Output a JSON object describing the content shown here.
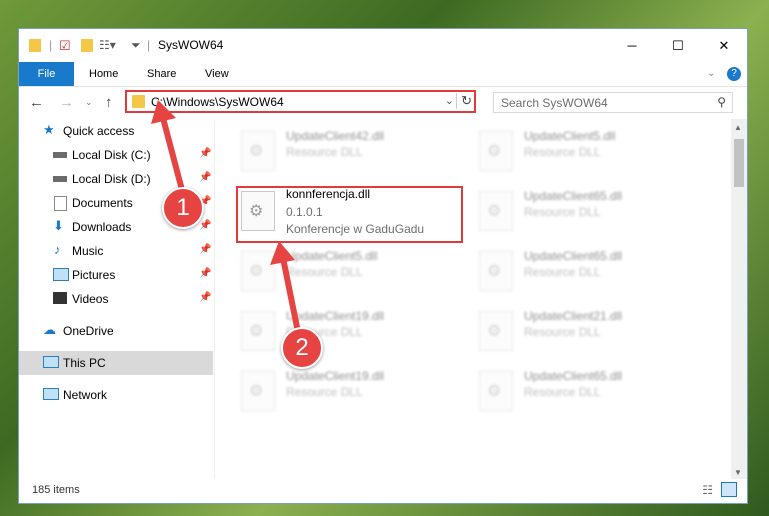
{
  "window": {
    "title": "SysWOW64"
  },
  "ribbon": {
    "tabs": [
      "File",
      "Home",
      "Share",
      "View"
    ]
  },
  "address": {
    "path": "C:\\Windows\\SysWOW64"
  },
  "search": {
    "placeholder": "Search SysWOW64"
  },
  "nav": {
    "items": [
      {
        "label": "Quick access"
      },
      {
        "label": "Local Disk (C:)"
      },
      {
        "label": "Local Disk (D:)"
      },
      {
        "label": "Documents"
      },
      {
        "label": "Downloads"
      },
      {
        "label": "Music"
      },
      {
        "label": "Pictures"
      },
      {
        "label": "Videos"
      },
      {
        "label": "OneDrive"
      },
      {
        "label": "This PC"
      },
      {
        "label": "Network"
      }
    ]
  },
  "files": [
    {
      "name": "UpdateClient42.dll",
      "sub": "Resource DLL"
    },
    {
      "name": "UpdateClient5.dll",
      "sub": "Resource DLL"
    },
    {
      "name": "konnferencja.dll",
      "sub": "0.1.0.1",
      "sub2": "Konferencje w GaduGadu"
    },
    {
      "name": "UpdateClient65.dll",
      "sub": "Resource DLL"
    },
    {
      "name": "UpdateClient5.dll",
      "sub": "Resource DLL"
    },
    {
      "name": "UpdateClient65.dll",
      "sub": "Resource DLL"
    },
    {
      "name": "UpdateClient19.dll",
      "sub": "Resource DLL"
    },
    {
      "name": "UpdateClient21.dll",
      "sub": "Resource DLL"
    },
    {
      "name": "UpdateClient19.dll",
      "sub": "Resource DLL"
    },
    {
      "name": "UpdateClient65.dll",
      "sub": "Resource DLL"
    }
  ],
  "status": {
    "count": "185 items"
  },
  "annotations": {
    "badge1": "1",
    "badge2": "2"
  },
  "colors": {
    "accent": "#1979ca",
    "highlight": "#e03b3b",
    "folder": "#f4c746"
  }
}
